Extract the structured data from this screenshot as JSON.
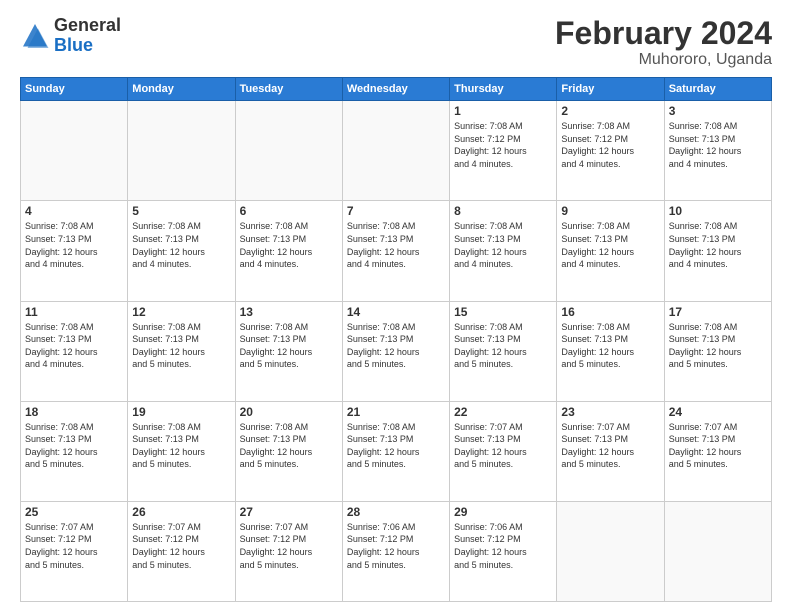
{
  "logo": {
    "general": "General",
    "blue": "Blue"
  },
  "header": {
    "month": "February 2024",
    "location": "Muhororo, Uganda"
  },
  "weekdays": [
    "Sunday",
    "Monday",
    "Tuesday",
    "Wednesday",
    "Thursday",
    "Friday",
    "Saturday"
  ],
  "weeks": [
    [
      {
        "day": "",
        "info": ""
      },
      {
        "day": "",
        "info": ""
      },
      {
        "day": "",
        "info": ""
      },
      {
        "day": "",
        "info": ""
      },
      {
        "day": "1",
        "info": "Sunrise: 7:08 AM\nSunset: 7:12 PM\nDaylight: 12 hours\nand 4 minutes."
      },
      {
        "day": "2",
        "info": "Sunrise: 7:08 AM\nSunset: 7:12 PM\nDaylight: 12 hours\nand 4 minutes."
      },
      {
        "day": "3",
        "info": "Sunrise: 7:08 AM\nSunset: 7:13 PM\nDaylight: 12 hours\nand 4 minutes."
      }
    ],
    [
      {
        "day": "4",
        "info": "Sunrise: 7:08 AM\nSunset: 7:13 PM\nDaylight: 12 hours\nand 4 minutes."
      },
      {
        "day": "5",
        "info": "Sunrise: 7:08 AM\nSunset: 7:13 PM\nDaylight: 12 hours\nand 4 minutes."
      },
      {
        "day": "6",
        "info": "Sunrise: 7:08 AM\nSunset: 7:13 PM\nDaylight: 12 hours\nand 4 minutes."
      },
      {
        "day": "7",
        "info": "Sunrise: 7:08 AM\nSunset: 7:13 PM\nDaylight: 12 hours\nand 4 minutes."
      },
      {
        "day": "8",
        "info": "Sunrise: 7:08 AM\nSunset: 7:13 PM\nDaylight: 12 hours\nand 4 minutes."
      },
      {
        "day": "9",
        "info": "Sunrise: 7:08 AM\nSunset: 7:13 PM\nDaylight: 12 hours\nand 4 minutes."
      },
      {
        "day": "10",
        "info": "Sunrise: 7:08 AM\nSunset: 7:13 PM\nDaylight: 12 hours\nand 4 minutes."
      }
    ],
    [
      {
        "day": "11",
        "info": "Sunrise: 7:08 AM\nSunset: 7:13 PM\nDaylight: 12 hours\nand 4 minutes."
      },
      {
        "day": "12",
        "info": "Sunrise: 7:08 AM\nSunset: 7:13 PM\nDaylight: 12 hours\nand 5 minutes."
      },
      {
        "day": "13",
        "info": "Sunrise: 7:08 AM\nSunset: 7:13 PM\nDaylight: 12 hours\nand 5 minutes."
      },
      {
        "day": "14",
        "info": "Sunrise: 7:08 AM\nSunset: 7:13 PM\nDaylight: 12 hours\nand 5 minutes."
      },
      {
        "day": "15",
        "info": "Sunrise: 7:08 AM\nSunset: 7:13 PM\nDaylight: 12 hours\nand 5 minutes."
      },
      {
        "day": "16",
        "info": "Sunrise: 7:08 AM\nSunset: 7:13 PM\nDaylight: 12 hours\nand 5 minutes."
      },
      {
        "day": "17",
        "info": "Sunrise: 7:08 AM\nSunset: 7:13 PM\nDaylight: 12 hours\nand 5 minutes."
      }
    ],
    [
      {
        "day": "18",
        "info": "Sunrise: 7:08 AM\nSunset: 7:13 PM\nDaylight: 12 hours\nand 5 minutes."
      },
      {
        "day": "19",
        "info": "Sunrise: 7:08 AM\nSunset: 7:13 PM\nDaylight: 12 hours\nand 5 minutes."
      },
      {
        "day": "20",
        "info": "Sunrise: 7:08 AM\nSunset: 7:13 PM\nDaylight: 12 hours\nand 5 minutes."
      },
      {
        "day": "21",
        "info": "Sunrise: 7:08 AM\nSunset: 7:13 PM\nDaylight: 12 hours\nand 5 minutes."
      },
      {
        "day": "22",
        "info": "Sunrise: 7:07 AM\nSunset: 7:13 PM\nDaylight: 12 hours\nand 5 minutes."
      },
      {
        "day": "23",
        "info": "Sunrise: 7:07 AM\nSunset: 7:13 PM\nDaylight: 12 hours\nand 5 minutes."
      },
      {
        "day": "24",
        "info": "Sunrise: 7:07 AM\nSunset: 7:13 PM\nDaylight: 12 hours\nand 5 minutes."
      }
    ],
    [
      {
        "day": "25",
        "info": "Sunrise: 7:07 AM\nSunset: 7:12 PM\nDaylight: 12 hours\nand 5 minutes."
      },
      {
        "day": "26",
        "info": "Sunrise: 7:07 AM\nSunset: 7:12 PM\nDaylight: 12 hours\nand 5 minutes."
      },
      {
        "day": "27",
        "info": "Sunrise: 7:07 AM\nSunset: 7:12 PM\nDaylight: 12 hours\nand 5 minutes."
      },
      {
        "day": "28",
        "info": "Sunrise: 7:06 AM\nSunset: 7:12 PM\nDaylight: 12 hours\nand 5 minutes."
      },
      {
        "day": "29",
        "info": "Sunrise: 7:06 AM\nSunset: 7:12 PM\nDaylight: 12 hours\nand 5 minutes."
      },
      {
        "day": "",
        "info": ""
      },
      {
        "day": "",
        "info": ""
      }
    ]
  ]
}
